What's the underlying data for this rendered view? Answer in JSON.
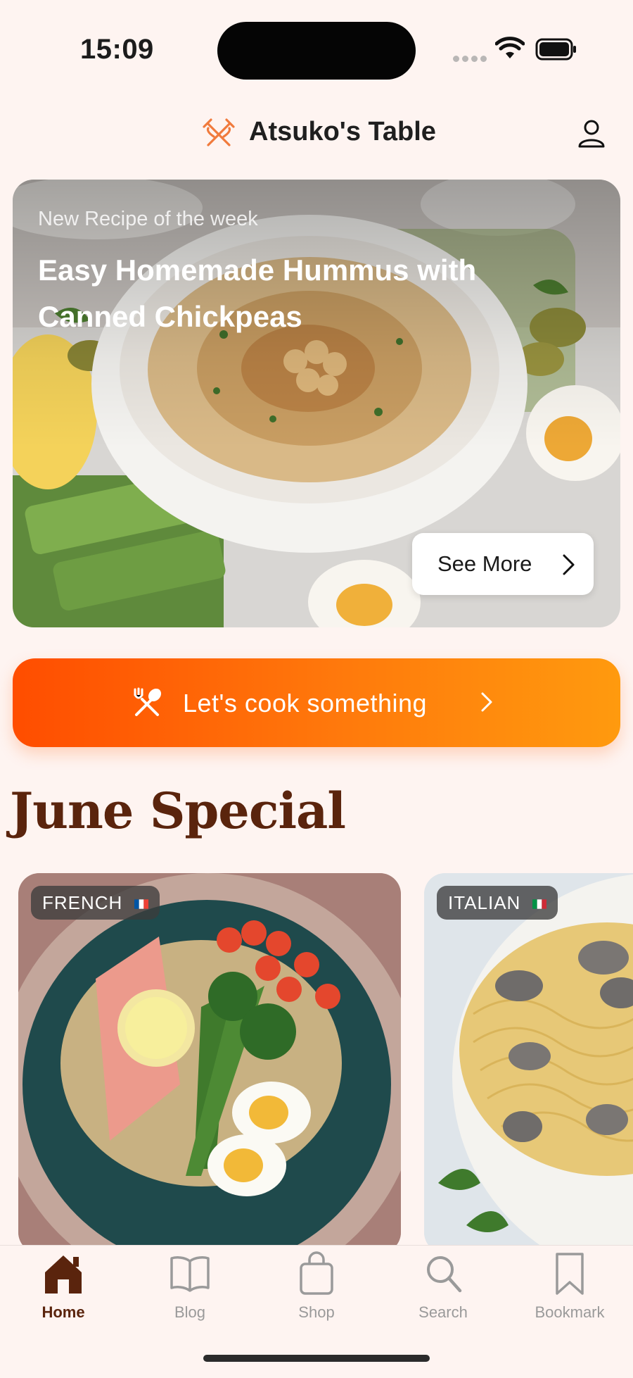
{
  "status_bar": {
    "time": "15:09"
  },
  "header": {
    "title": "Atsuko's Table",
    "logo_icon": "chef-utensils-icon",
    "profile_icon": "person-icon"
  },
  "hero": {
    "eyebrow": "New Recipe of the week",
    "title": "Easy Homemade Hummus with Canned Chickpeas",
    "see_more_label": "See More"
  },
  "cta": {
    "label": "Let's cook something",
    "icon": "fork-spoon-crossed-icon"
  },
  "section": {
    "title": "June Special"
  },
  "cards": [
    {
      "tag": "FRENCH",
      "flag": "fr"
    },
    {
      "tag": "ITALIAN",
      "flag": "it"
    }
  ],
  "tabs": [
    {
      "label": "Home",
      "icon": "home-icon",
      "active": true
    },
    {
      "label": "Blog",
      "icon": "book-icon",
      "active": false
    },
    {
      "label": "Shop",
      "icon": "shopping-bag-icon",
      "active": false
    },
    {
      "label": "Search",
      "icon": "search-icon",
      "active": false
    },
    {
      "label": "Bookmark",
      "icon": "bookmark-icon",
      "active": false
    }
  ],
  "colors": {
    "accent_start": "#ff4d00",
    "accent_end": "#ff9a0e",
    "section_title": "#5a240d",
    "background": "#fef4f1"
  }
}
